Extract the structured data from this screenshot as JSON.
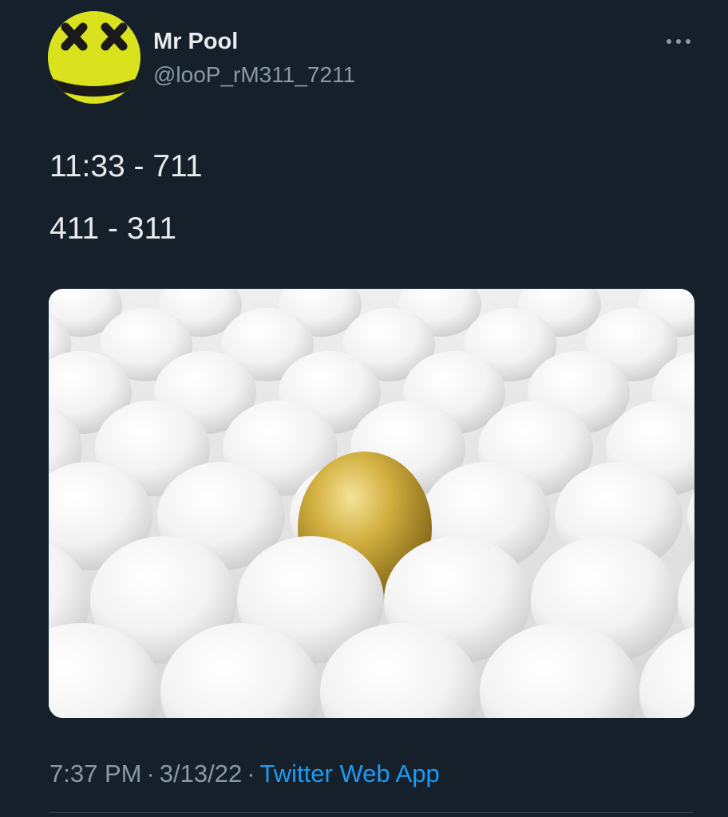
{
  "author": {
    "display_name": "Mr Pool",
    "handle": "@looP_rM311_7211",
    "avatar_icon": "yellow-dead-smiley-avatar"
  },
  "header": {
    "more_icon": "more-horizontal-icon"
  },
  "tweet": {
    "lines": [
      "11:33 - 711",
      "411 - 311"
    ],
    "image_description": "golden-egg-among-white-eggs"
  },
  "meta": {
    "time": "7:37 PM",
    "separator": "·",
    "date": "3/13/22",
    "source": "Twitter Web App"
  },
  "colors": {
    "background": "#15202b",
    "text": "#e7e9ea",
    "secondary_text": "#8b98a5",
    "link": "#1d9bf0",
    "avatar_yellow": "#d9e21c",
    "gold_egg": "#c9a62b"
  }
}
